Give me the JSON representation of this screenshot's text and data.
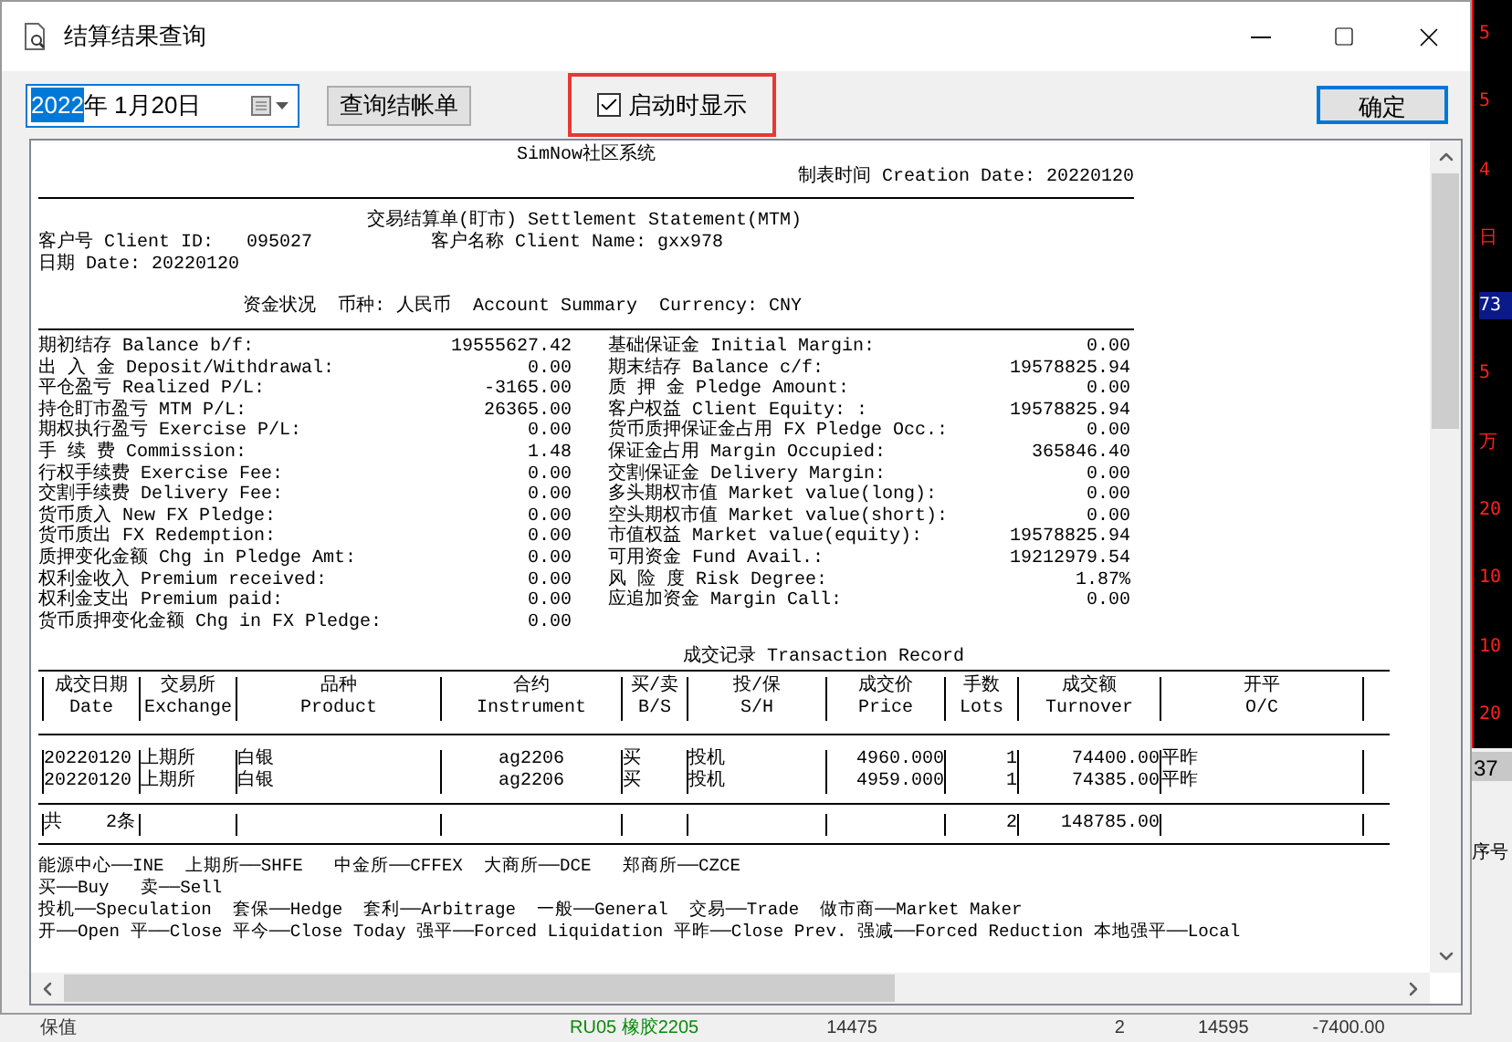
{
  "window": {
    "title": "结算结果查询"
  },
  "toolbar": {
    "date_field": {
      "selected_text": "2022",
      "rest_text": "年 1月20日"
    },
    "query_button": "查询结帐单",
    "startup_checkbox": {
      "label": "启动时显示",
      "checked": true
    },
    "confirm_button": "确定"
  },
  "report": {
    "system": "SimNow社区系统",
    "creation_date": "制表时间 Creation Date: 20220120",
    "title": "交易结算单(盯市) Settlement Statement(MTM)",
    "client_id": "客户号 Client ID:   095027",
    "client_name": "客户名称 Client Name: gxx978",
    "date": "日期 Date: 20220120",
    "summary_heading": "资金状况  币种: 人民币  Account Summary  Currency: CNY",
    "summary_left": [
      {
        "label": "期初结存 Balance b/f:",
        "value": "19555627.42"
      },
      {
        "label": "出 入 金 Deposit/Withdrawal:",
        "value": "0.00"
      },
      {
        "label": "平仓盈亏 Realized P/L:",
        "value": "-3165.00"
      },
      {
        "label": "持仓盯市盈亏 MTM P/L:",
        "value": "26365.00"
      },
      {
        "label": "期权执行盈亏 Exercise P/L:",
        "value": "0.00"
      },
      {
        "label": "手 续 费 Commission:",
        "value": "1.48"
      },
      {
        "label": "行权手续费 Exercise Fee:",
        "value": "0.00"
      },
      {
        "label": "交割手续费 Delivery Fee:",
        "value": "0.00"
      },
      {
        "label": "货币质入 New FX Pledge:",
        "value": "0.00"
      },
      {
        "label": "货币质出 FX Redemption:",
        "value": "0.00"
      },
      {
        "label": "质押变化金额 Chg in Pledge Amt:",
        "value": "0.00"
      },
      {
        "label": "权利金收入 Premium received:",
        "value": "0.00"
      },
      {
        "label": "权利金支出 Premium paid:",
        "value": "0.00"
      },
      {
        "label": "货币质押变化金额 Chg in FX Pledge:",
        "value": "0.00"
      }
    ],
    "summary_right": [
      {
        "label": "基础保证金 Initial Margin:",
        "value": "0.00"
      },
      {
        "label": "期末结存 Balance c/f:",
        "value": "19578825.94"
      },
      {
        "label": "质 押 金 Pledge Amount:",
        "value": "0.00"
      },
      {
        "label": "客户权益 Client Equity: :",
        "value": "19578825.94"
      },
      {
        "label": "货币质押保证金占用 FX Pledge Occ.:",
        "value": "0.00"
      },
      {
        "label": "保证金占用 Margin Occupied:",
        "value": "365846.40"
      },
      {
        "label": "交割保证金 Delivery Margin:",
        "value": "0.00"
      },
      {
        "label": "多头期权市值 Market value(long):",
        "value": "0.00"
      },
      {
        "label": "空头期权市值 Market value(short):",
        "value": "0.00"
      },
      {
        "label": "市值权益 Market value(equity):",
        "value": "19578825.94"
      },
      {
        "label": "可用资金 Fund Avail.:",
        "value": "19212979.54"
      },
      {
        "label": "风 险 度 Risk Degree:",
        "value": "1.87%"
      },
      {
        "label": "应追加资金 Margin Call:",
        "value": "0.00"
      }
    ],
    "transaction_heading": "成交记录 Transaction Record",
    "columns": [
      {
        "zh": "成交日期",
        "en": "Date"
      },
      {
        "zh": "交易所",
        "en": "Exchange"
      },
      {
        "zh": "品种",
        "en": "Product"
      },
      {
        "zh": "合约",
        "en": "Instrument"
      },
      {
        "zh": "买/卖",
        "en": "B/S"
      },
      {
        "zh": "投/保",
        "en": "S/H"
      },
      {
        "zh": "成交价",
        "en": "Price"
      },
      {
        "zh": "手数",
        "en": "Lots"
      },
      {
        "zh": "成交额",
        "en": "Turnover"
      },
      {
        "zh": "开平",
        "en": "O/C"
      }
    ],
    "rows": [
      [
        "20220120",
        "上期所",
        "白银",
        "ag2206",
        "买",
        "投机",
        "4960.000",
        "1",
        "74400.00",
        "平昨"
      ],
      [
        "20220120",
        "上期所",
        "白银",
        "ag2206",
        "买",
        "投机",
        "4959.000",
        "1",
        "74385.00",
        "平昨"
      ]
    ],
    "total": {
      "label": "共    2条",
      "lots": "2",
      "turnover": "148785.00"
    },
    "legend": [
      "能源中心──INE  上期所──SHFE   中金所──CFFEX  大商所──DCE   郑商所──CZCE",
      "买──Buy   卖──Sell",
      "投机──Speculation  套保──Hedge  套利──Arbitrage  一般──General  交易──Trade  做市商──Market Maker",
      "开──Open 平──Close 平今──Close Today 强平──Forced Liquidation 平昨──Close Prev. 强减──Forced Reduction 本地强平──Local"
    ]
  },
  "background": {
    "chart_labels": [
      "5",
      "5",
      "4",
      "日",
      "73",
      "5",
      "万",
      "20",
      "10",
      "10",
      "20"
    ],
    "grid_value": "37",
    "grid_header": "序号",
    "bottom_row": [
      "保值",
      "RU05 橡胶2205",
      "14475",
      "2",
      "14595",
      "-7400.00"
    ]
  }
}
